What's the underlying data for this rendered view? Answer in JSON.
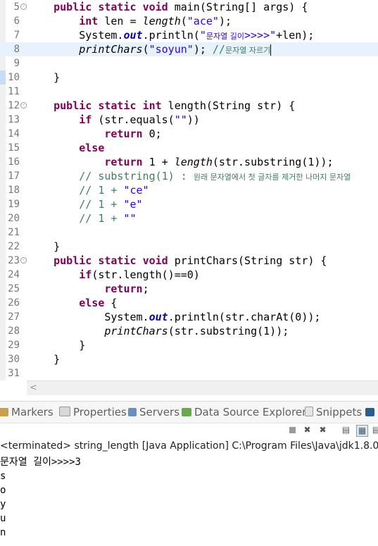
{
  "editor": {
    "lines": [
      {
        "n": "5",
        "fold": true,
        "html": "    <span class=\"kw\">public</span> <span class=\"kw\">static</span> <span class=\"kw\">void</span> main(String[] args) {"
      },
      {
        "n": "6",
        "html": "        <span class=\"kw\">int</span> len = <span class=\"it\">length</span>(<span class=\"str\">\"ace\"</span>);"
      },
      {
        "n": "7",
        "html": "        System.<span class=\"fld\">out</span>.println(<span class=\"str\">\"<span class=\"ko\">문자열 길이</span>&gt;&gt;&gt;&gt;\"</span>+len);"
      },
      {
        "n": "8",
        "current": true,
        "html": "        <span class=\"it\">printChars</span>(<span class=\"str\">\"soyun\"</span>); <span class=\"cmt\">//<span class=\"ko\">문자열 자르기</span></span><span class=\"caret\"></span>"
      },
      {
        "n": "9",
        "html": ""
      },
      {
        "n": "10",
        "html": "    }"
      },
      {
        "n": "11",
        "html": ""
      },
      {
        "n": "12",
        "fold": true,
        "html": "    <span class=\"kw\">public</span> <span class=\"kw\">static</span> <span class=\"kw\">int</span> length(String str) {"
      },
      {
        "n": "13",
        "html": "        <span class=\"kw\">if</span> (str.equals(<span class=\"str\">\"\"</span>))"
      },
      {
        "n": "14",
        "html": "            <span class=\"kw\">return</span> 0;"
      },
      {
        "n": "15",
        "html": "        <span class=\"kw\">else</span>"
      },
      {
        "n": "16",
        "html": "            <span class=\"kw\">return</span> 1 + <span class=\"it\">length</span>(str.substring(1));"
      },
      {
        "n": "17",
        "html": "        <span class=\"cmt\">// substring(1) : <span class=\"ko\">원래 문자열에서 첫 글자를 제거한 나머지 문자열</span></span>"
      },
      {
        "n": "18",
        "html": "        <span class=\"cmt\">// 1 + </span><span class=\"str\">\"ce\"</span>"
      },
      {
        "n": "19",
        "html": "        <span class=\"cmt\">// 1 + </span><span class=\"str\">\"e\"</span>"
      },
      {
        "n": "20",
        "html": "        <span class=\"cmt\">// 1 + </span><span class=\"str\">\"\"</span>"
      },
      {
        "n": "21",
        "html": ""
      },
      {
        "n": "22",
        "html": "    }"
      },
      {
        "n": "23",
        "fold": true,
        "html": "    <span class=\"kw\">public</span> <span class=\"kw\">static</span> <span class=\"kw\">void</span> printChars(String str) {"
      },
      {
        "n": "24",
        "html": "        <span class=\"kw\">if</span>(str.length()==0)"
      },
      {
        "n": "25",
        "html": "            <span class=\"kw\">return</span>;"
      },
      {
        "n": "26",
        "html": "        <span class=\"kw\">else</span> {"
      },
      {
        "n": "27",
        "html": "            System.<span class=\"fld\">out</span>.println(str.charAt(0));"
      },
      {
        "n": "28",
        "html": "            <span class=\"it\">printChars</span>(str.substring(1));"
      },
      {
        "n": "29",
        "html": "        }"
      },
      {
        "n": "30",
        "html": "    }"
      },
      {
        "n": "31",
        "html": ""
      }
    ]
  },
  "views": {
    "tabs": [
      {
        "id": "markers",
        "label": "Markers",
        "icon": "markers-icon",
        "color": "#c9a04a"
      },
      {
        "id": "properties",
        "label": "Properties",
        "icon": "properties-icon",
        "color": "#8a8a8a"
      },
      {
        "id": "servers",
        "label": "Servers",
        "icon": "servers-icon",
        "color": "#6b8fb8"
      },
      {
        "id": "datasource",
        "label": "Data Source Explorer",
        "icon": "data-source-explorer-icon",
        "color": "#6aa84f"
      },
      {
        "id": "snippets",
        "label": "Snippets",
        "icon": "snippets-icon",
        "color": "#9b9b9b"
      }
    ]
  },
  "console": {
    "header": "<terminated> string_length [Java Application] C:\\Program Files\\Java\\jdk1.8.0_",
    "output": [
      "문자열 길이>>>>3",
      "s",
      "o",
      "y",
      "u",
      "n"
    ]
  }
}
